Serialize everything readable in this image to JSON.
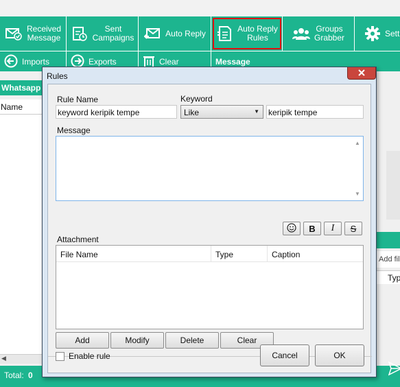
{
  "toolbar": {
    "received_message": [
      "Received",
      "Message"
    ],
    "sent_campaigns": [
      "Sent",
      "Campaigns"
    ],
    "auto_reply": "Auto Reply",
    "auto_reply_rules": [
      "Auto Reply",
      "Rules"
    ],
    "groups_grabber": [
      "Groups",
      "Grabber"
    ],
    "settings": "Setti"
  },
  "toolbar2": {
    "imports": "Imports",
    "exports": "Exports",
    "clear": "Clear",
    "message": "Message"
  },
  "left_panel": {
    "header": "Whatsapp",
    "column_name": "Name"
  },
  "right_panel": {
    "add_file": "Add file",
    "column_type": "Typ"
  },
  "status": {
    "total_label": "Total:",
    "total_value": "0"
  },
  "dialog": {
    "title": "Rules",
    "rule_name_label": "Rule Name",
    "rule_name_value": "keyword keripik tempe",
    "keyword_label": "Keyword",
    "keyword_match": "Like",
    "keyword_value": "keripik tempe",
    "message_label": "Message",
    "message_value": "",
    "attachment_label": "Attachment",
    "columns": [
      "File Name",
      "Type",
      "Caption"
    ],
    "buttons": {
      "add": "Add",
      "modify": "Modify",
      "delete": "Delete",
      "clear": "Clear"
    },
    "enable_rule_label": "Enable rule",
    "enable_rule_checked": false,
    "cancel": "Cancel",
    "ok": "OK"
  },
  "colors": {
    "brand_green": "#1db58f",
    "highlight_red": "#e01010",
    "close_red": "#c9463d",
    "dialog_frame": "#dbe7f3"
  }
}
